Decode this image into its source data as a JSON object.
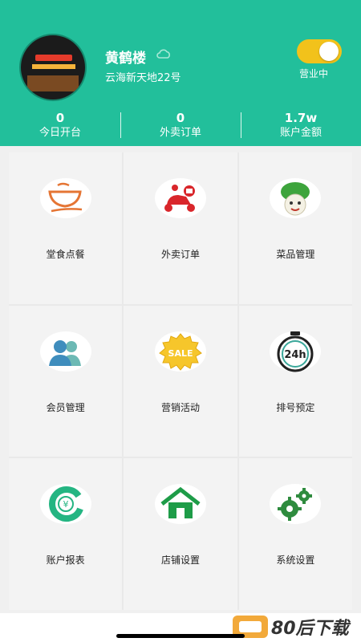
{
  "header": {
    "store_name": "黄鹤楼",
    "address": "云海新天地22号",
    "status_label": "营业中",
    "toggle_on": true,
    "accent": "#22bf9b",
    "toggle_color": "#f2c21b",
    "stats": [
      {
        "value": "0",
        "label": "今日开台"
      },
      {
        "value": "0",
        "label": "外卖订单"
      },
      {
        "value": "1.7w",
        "label": "账户金额"
      }
    ]
  },
  "menu": {
    "items": [
      {
        "label": "堂食点餐",
        "icon": "bowl-icon"
      },
      {
        "label": "外卖订单",
        "icon": "delivery-scooter-icon"
      },
      {
        "label": "菜品管理",
        "icon": "cabbage-icon"
      },
      {
        "label": "会员管理",
        "icon": "members-icon"
      },
      {
        "label": "营销活动",
        "icon": "sale-badge-icon",
        "badge_text": "SALE"
      },
      {
        "label": "排号预定",
        "icon": "stopwatch-24h-icon",
        "badge_text": "24h"
      },
      {
        "label": "账户报表",
        "icon": "yuan-report-icon",
        "badge_text": "¥"
      },
      {
        "label": "店铺设置",
        "icon": "house-icon"
      },
      {
        "label": "系统设置",
        "icon": "gears-icon"
      }
    ]
  },
  "watermark": {
    "text": "80后下载"
  }
}
